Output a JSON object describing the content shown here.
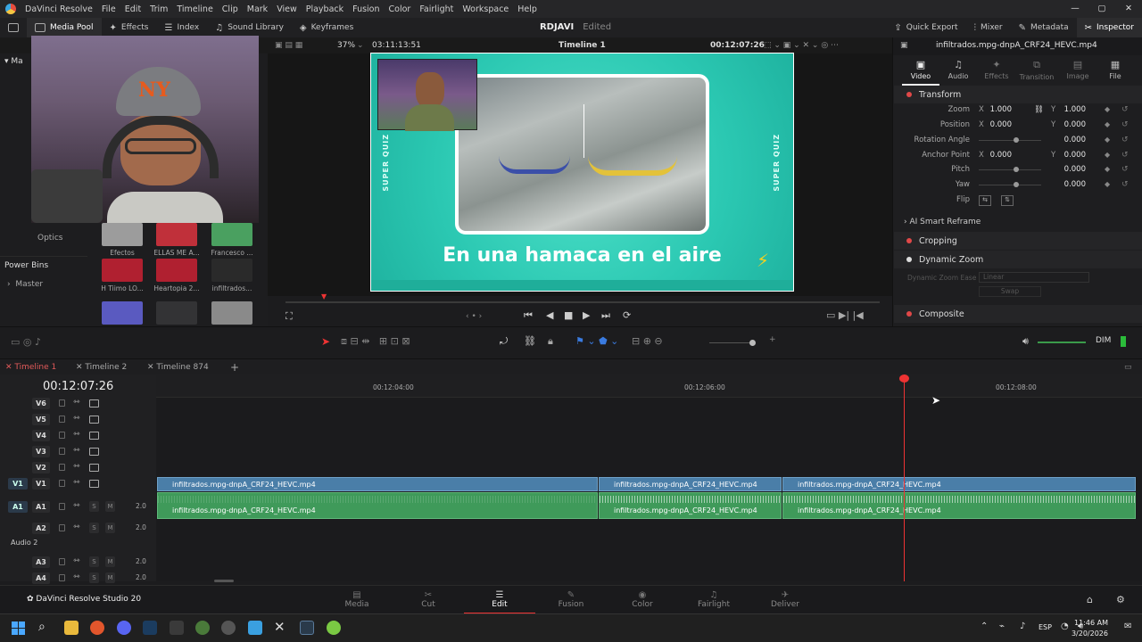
{
  "titlebar": {
    "app": "DaVinci Resolve",
    "menus": [
      "File",
      "Edit",
      "Trim",
      "Timeline",
      "Clip",
      "Mark",
      "View",
      "Playback",
      "Fusion",
      "Color",
      "Fairlight",
      "Workspace",
      "Help"
    ]
  },
  "toolbar": {
    "media_pool": "Media Pool",
    "effects": "Effects",
    "index": "Index",
    "sound_library": "Sound Library",
    "keyframes": "Keyframes",
    "project": "RDJAVI",
    "project_status": "Edited",
    "quick_export": "Quick Export",
    "mixer": "Mixer",
    "metadata": "Metadata",
    "inspector": "Inspector"
  },
  "left": {
    "bins": [
      "Optics"
    ],
    "power_bins": "Power Bins",
    "master": "Master",
    "media": [
      {
        "label": "Efectos",
        "color": "#9c9c9c"
      },
      {
        "label": "ELLAS ME A...",
        "color": "#c0303a"
      },
      {
        "label": "Francesco ...",
        "color": "#4aa060"
      },
      {
        "label": "H Tiimo LO...",
        "color": "#b02030"
      },
      {
        "label": "Heartopia 2...",
        "color": "#b02030"
      },
      {
        "label": "infiltrados...",
        "color": "#2a2a2a"
      },
      {
        "label": "",
        "color": "#5a5ac0"
      },
      {
        "label": "",
        "color": "#333335"
      },
      {
        "label": "",
        "color": "#8a8a8a"
      }
    ]
  },
  "viewer": {
    "zoom": "37%",
    "source_tc": "03:11:13:51",
    "timeline_name": "Timeline 1",
    "timecode": "00:12:07:26",
    "caption": "En una hamaca en el aire",
    "side_text": "SUPER QUIZ"
  },
  "inspector": {
    "clip_name": "infiltrados.mpg-dnpA_CRF24_HEVC.mp4",
    "tabs": [
      "Video",
      "Audio",
      "Effects",
      "Transition",
      "Image",
      "File"
    ],
    "transform": "Transform",
    "rows": [
      {
        "label": "Zoom",
        "x": "1.000",
        "y": "1.000"
      },
      {
        "label": "Position",
        "x": "0.000",
        "y": "0.000"
      },
      {
        "label": "Rotation Angle",
        "v": "0.000"
      },
      {
        "label": "Anchor Point",
        "x": "0.000",
        "y": "0.000"
      },
      {
        "label": "Pitch",
        "v": "0.000"
      },
      {
        "label": "Yaw",
        "v": "0.000"
      },
      {
        "label": "Flip"
      }
    ],
    "ai_reframe": "AI Smart Reframe",
    "cropping": "Cropping",
    "dynamic_zoom": "Dynamic Zoom",
    "dz_ease_label": "Dynamic Zoom Ease",
    "dz_ease_value": "Linear",
    "swap": "Swap",
    "composite": "Composite"
  },
  "audio": {
    "dim": "DIM"
  },
  "timeline": {
    "tabs": [
      "Timeline 1",
      "Timeline 2",
      "Timeline 874"
    ],
    "timecode": "00:12:07:26",
    "ruler": [
      "00:12:04:00",
      "00:12:06:00",
      "00:12:08:00"
    ],
    "video_tracks": [
      "V6",
      "V5",
      "V4",
      "V3",
      "V2",
      "V1"
    ],
    "audio_tracks": [
      "A1",
      "A2",
      "A3",
      "A4"
    ],
    "audio2_label": "Audio 2",
    "vol": "2.0",
    "clip_name": "infiltrados.mpg-dnpA_CRF24_HEVC.mp4"
  },
  "pages": {
    "studio": "DaVinci Resolve Studio 20",
    "items": [
      "Media",
      "Cut",
      "Edit",
      "Fusion",
      "Color",
      "Fairlight",
      "Deliver"
    ]
  },
  "taskbar": {
    "lang": "ESP",
    "time": "11:46 AM",
    "date": "3/20/2026"
  }
}
